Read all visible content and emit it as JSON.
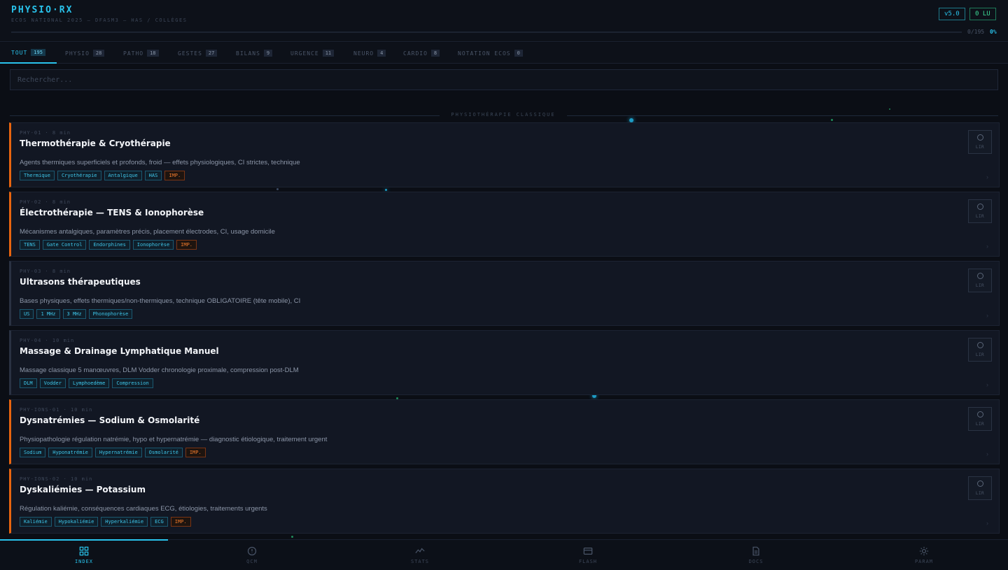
{
  "header": {
    "brand": "PHYSIO·RX",
    "subtitle": "ECOS NATIONAL 2025 — DFASM3 — HAS / COLLÈGES",
    "version": "v5.0",
    "read_badge": "0 LU",
    "progress_count": "0/195",
    "progress_percent": "0%",
    "progress_fraction": 0
  },
  "tabs": [
    {
      "label": "TOUT",
      "count": "195",
      "active": true
    },
    {
      "label": "PHYSIO",
      "count": "28",
      "active": false
    },
    {
      "label": "PATHO",
      "count": "18",
      "active": false
    },
    {
      "label": "GESTES",
      "count": "27",
      "active": false
    },
    {
      "label": "BILANS",
      "count": "9",
      "active": false
    },
    {
      "label": "URGENCE",
      "count": "11",
      "active": false
    },
    {
      "label": "NEURO",
      "count": "4",
      "active": false
    },
    {
      "label": "CARDIO",
      "count": "8",
      "active": false
    },
    {
      "label": "NOTATION ECOS",
      "count": "0",
      "active": false
    }
  ],
  "search": {
    "placeholder": "Rechercher..."
  },
  "section": {
    "label": "PHYSIOTHÉRAPIE CLASSIQUE"
  },
  "cards": [
    {
      "meta": "PHY-01 · 8 min",
      "title": "Thermothérapie & Cryothérapie",
      "desc": "Agents thermiques superficiels et profonds, froid — effets physiologiques, CI strictes, technique",
      "tags": [
        "Thermique",
        "Cryothérapie",
        "Antalgique",
        "HAS"
      ],
      "imp": true,
      "imp_label": "IMP.",
      "read_label": "LIR",
      "accent": "#e8650f"
    },
    {
      "meta": "PHY-02 · 8 min",
      "title": "Électrothérapie — TENS & Ionophorèse",
      "desc": "Mécanismes antalgiques, paramètres précis, placement électrodes, CI, usage domicile",
      "tags": [
        "TENS",
        "Gate Control",
        "Endorphines",
        "Ionophorèse"
      ],
      "imp": true,
      "imp_label": "IMP.",
      "read_label": "LIR",
      "accent": "#e8650f"
    },
    {
      "meta": "PHY-03 · 8 min",
      "title": "Ultrasons thérapeutiques",
      "desc": "Bases physiques, effets thermiques/non-thermiques, technique OBLIGATOIRE (tête mobile), CI",
      "tags": [
        "US",
        "1 MHz",
        "3 MHz",
        "Phonophorèse"
      ],
      "imp": false,
      "imp_label": "",
      "read_label": "LIR",
      "accent": "#2a3242"
    },
    {
      "meta": "PHY-04 · 10 min",
      "title": "Massage & Drainage Lymphatique Manuel",
      "desc": "Massage classique 5 manœuvres, DLM Vodder chronologie proximale, compression post-DLM",
      "tags": [
        "DLM",
        "Vodder",
        "Lymphoedème",
        "Compression"
      ],
      "imp": false,
      "imp_label": "",
      "read_label": "LIR",
      "accent": "#2a3242"
    },
    {
      "meta": "PHY-IONS-01 · 10 min",
      "title": "Dysnatrémies — Sodium & Osmolarité",
      "desc": "Physiopathologie régulation natrémie, hypo et hypernatrémie — diagnostic étiologique, traitement urgent",
      "tags": [
        "Sodium",
        "Hyponatrémie",
        "Hypernatrémie",
        "Osmolarité"
      ],
      "imp": true,
      "imp_label": "IMP.",
      "read_label": "LIR",
      "accent": "#e8650f"
    },
    {
      "meta": "PHY-IONS-02 · 10 min",
      "title": "Dyskaliémies — Potassium",
      "desc": "Régulation kaliémie, conséquences cardiaques ECG, étiologies, traitements urgents",
      "tags": [
        "Kaliémie",
        "Hypokaliémie",
        "Hyperkaliémie",
        "ECG"
      ],
      "imp": true,
      "imp_label": "IMP.",
      "read_label": "LIR",
      "accent": "#e8650f"
    }
  ],
  "nav": [
    {
      "label": "INDEX",
      "icon": "grid-icon",
      "active": true
    },
    {
      "label": "QCM",
      "icon": "alert-circle-icon",
      "active": false
    },
    {
      "label": "STATS",
      "icon": "activity-icon",
      "active": false
    },
    {
      "label": "FLASH",
      "icon": "card-icon",
      "active": false
    },
    {
      "label": "DOCS",
      "icon": "document-icon",
      "active": false
    },
    {
      "label": "PARAM",
      "icon": "sun-gear-icon",
      "active": false
    }
  ],
  "colors": {
    "accent": "#29c3ec",
    "important": "#e8650f",
    "read": "#3ddc97",
    "background": "#0b0e15"
  }
}
